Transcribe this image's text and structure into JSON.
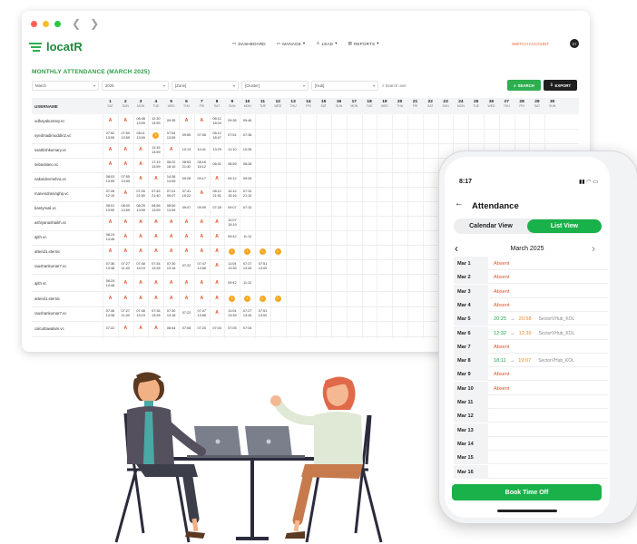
{
  "desktop": {
    "brand": "locatR",
    "menu": [
      "DASHBOARD",
      "MANAGE",
      "LEAD",
      "REPORTS"
    ],
    "switch_account": "SWITCH ACCOUNT",
    "avatar_initials": "ST",
    "page_title": "MONTHLY ATTENDANCE (MARCH 2025)",
    "filters": {
      "month": "March",
      "year": "2025",
      "zone": "[Zone]",
      "cluster": "[Cluster]",
      "hub": "[Hub]",
      "search_placeholder": "Search user"
    },
    "search_button": "SEARCH",
    "export_button": "EXPORT",
    "column_header": "USERNAME",
    "days": [
      {
        "n": "1",
        "d": "SAT"
      },
      {
        "n": "2",
        "d": "SUN"
      },
      {
        "n": "3",
        "d": "MON"
      },
      {
        "n": "4",
        "d": "TUE"
      },
      {
        "n": "5",
        "d": "WED"
      },
      {
        "n": "6",
        "d": "THU"
      },
      {
        "n": "7",
        "d": "FRI"
      },
      {
        "n": "8",
        "d": "SAT"
      },
      {
        "n": "9",
        "d": "SUN"
      },
      {
        "n": "10",
        "d": "MON"
      },
      {
        "n": "11",
        "d": "TUE"
      },
      {
        "n": "12",
        "d": "WED"
      },
      {
        "n": "13",
        "d": "THU"
      },
      {
        "n": "14",
        "d": "FRI"
      },
      {
        "n": "15",
        "d": "SAT"
      },
      {
        "n": "16",
        "d": "SUN"
      },
      {
        "n": "17",
        "d": "MON"
      },
      {
        "n": "18",
        "d": "TUE"
      },
      {
        "n": "19",
        "d": "WED"
      },
      {
        "n": "20",
        "d": "THU"
      },
      {
        "n": "21",
        "d": "FRI"
      },
      {
        "n": "22",
        "d": "SAT"
      },
      {
        "n": "23",
        "d": "SUN"
      },
      {
        "n": "24",
        "d": "MON"
      },
      {
        "n": "25",
        "d": "TUE"
      },
      {
        "n": "26",
        "d": "WED"
      },
      {
        "n": "27",
        "d": "THU"
      },
      {
        "n": "28",
        "d": "FRI"
      },
      {
        "n": "29",
        "d": "SAT"
      },
      {
        "n": "30",
        "d": "SUN"
      }
    ],
    "absent_mark": "A",
    "leave_mark": "L",
    "rows": [
      {
        "name": "udhayakumary.vc",
        "cells": [
          "A",
          "A",
          "08:48 13:59",
          "12:30 13:59",
          "09:35",
          "A",
          "A",
          "08:12 18:04",
          "09:35",
          "09:46"
        ]
      },
      {
        "name": "syedmadimuddin2.vc",
        "cells": [
          "07:52 13:59",
          "07:50 13:59",
          "08:11 13:59",
          "L",
          "07:54 13:59",
          "09:55",
          "07:06",
          "08:12 18:47",
          "07:51",
          "07:36"
        ]
      },
      {
        "name": "ssathishkumary.vc",
        "cells": [
          "A",
          "A",
          "A",
          "11:15 13:59",
          "A",
          "10:13",
          "10:41",
          "13:29",
          "11:10",
          "10:26"
        ]
      },
      {
        "name": "sebastiano.vc",
        "cells": [
          "A",
          "A",
          "A",
          "17:19 13:59",
          "08:22 18:10",
          "08:53 21:32",
          "08:16 16:12",
          "08:41",
          "08:59",
          "08:28"
        ]
      },
      {
        "name": "nakuldevmehra.vc",
        "cells": [
          "08:03 13:59",
          "07:55 13:59",
          "A",
          "A",
          "14:36 13:59",
          "09:28",
          "09:17",
          "A",
          "09:12",
          "09:09"
        ]
      },
      {
        "name": "manendrasinghp.vc",
        "cells": [
          "07:26 12:10",
          "A",
          "07:26 21:50",
          "07:45 21:40",
          "07:41 09:07",
          "07:41 15:22",
          "A",
          "08:12 21:51",
          "10:12 15:16",
          "07:31 21:10"
        ]
      },
      {
        "name": "bantymali.vc",
        "cells": [
          "08:01 13:59",
          "08:00 13:59",
          "08:25 13:59",
          "08:56 13:59",
          "08:50 13:59",
          "09:07",
          "09:09",
          "07:28",
          "09:07",
          "07:10"
        ]
      },
      {
        "name": "ashiyanashaikh.vc",
        "cells": [
          "A",
          "A",
          "A",
          "A",
          "A",
          "A",
          "A",
          "A",
          "10:07 15:19",
          ""
        ]
      },
      {
        "name": "ajith.vc",
        "cells": [
          "08:24 14:46",
          "A",
          "A",
          "A",
          "A",
          "A",
          "A",
          "A",
          "09:42",
          "11:12"
        ]
      },
      {
        "name": "attend1.sternic",
        "cells": [
          "A",
          "A",
          "A",
          "A",
          "A",
          "A",
          "A",
          "A",
          "L",
          "L",
          "L",
          "L"
        ]
      },
      {
        "name": "raushankumar7.vc",
        "cells": [
          "07:36 13:38",
          "07:27 11:40",
          "07:48 13:19",
          "07:34 13:28",
          "07:30 13:18",
          "07:22",
          "07:47 13:56",
          "A",
          "11:04 13:39",
          "07:27 13:44",
          "07:51 13:00"
        ]
      },
      {
        "name": "ajith.vc",
        "cells": [
          "08:24 14:46",
          "A",
          "A",
          "A",
          "A",
          "A",
          "A",
          "A",
          "09:42",
          "11:12"
        ]
      },
      {
        "name": "attend1.sternic",
        "cells": [
          "A",
          "A",
          "A",
          "A",
          "A",
          "A",
          "A",
          "A",
          "L",
          "L",
          "L",
          "L"
        ]
      },
      {
        "name": "raushankumar7.vc",
        "cells": [
          "07:36 13:38",
          "07:27 11:40",
          "07:48 13:19",
          "07:34 13:28",
          "07:30 13:18",
          "07:22",
          "07:47 13:56",
          "A",
          "11:04 13:39",
          "07:27 13:44",
          "07:51 13:00"
        ]
      },
      {
        "name": "calcuttawalam.vc",
        "cells": [
          "07:22",
          "A",
          "A",
          "A",
          "08:44",
          "07:08",
          "07:20",
          "07:04",
          "07:05",
          "07:04"
        ]
      }
    ]
  },
  "phone": {
    "time": "8:17",
    "title": "Attendance",
    "tab_calendar": "Calendar View",
    "tab_list": "List View",
    "month": "March 2025",
    "entries": [
      {
        "date": "Mar 1",
        "status": "Absent"
      },
      {
        "date": "Mar 2",
        "status": "Absent"
      },
      {
        "date": "Mar 3",
        "status": "Absent"
      },
      {
        "date": "Mar 4",
        "status": "Absent"
      },
      {
        "date": "Mar 5",
        "in": "20:25",
        "out": "20:58",
        "hub": "SectorVHub_KOL"
      },
      {
        "date": "Mar 6",
        "in": "12:32",
        "out": "12:39",
        "hub": "SectorVHub_KOL"
      },
      {
        "date": "Mar 7",
        "status": "Absent"
      },
      {
        "date": "Mar 8",
        "in": "18:11",
        "out": "19:07",
        "hub": "SectorVHub_KOL"
      },
      {
        "date": "Mar 9",
        "status": "Absent"
      },
      {
        "date": "Mar 10",
        "status": "Absent"
      },
      {
        "date": "Mar 11"
      },
      {
        "date": "Mar 12"
      },
      {
        "date": "Mar 13"
      },
      {
        "date": "Mar 14"
      },
      {
        "date": "Mar 15"
      },
      {
        "date": "Mar 16"
      }
    ],
    "book_button": "Book Time Off"
  },
  "colors": {
    "brand_green": "#2eae4f",
    "absent_red": "#e2532d",
    "leave_amber": "#f5a623",
    "checkout_orange": "#f0882a"
  }
}
